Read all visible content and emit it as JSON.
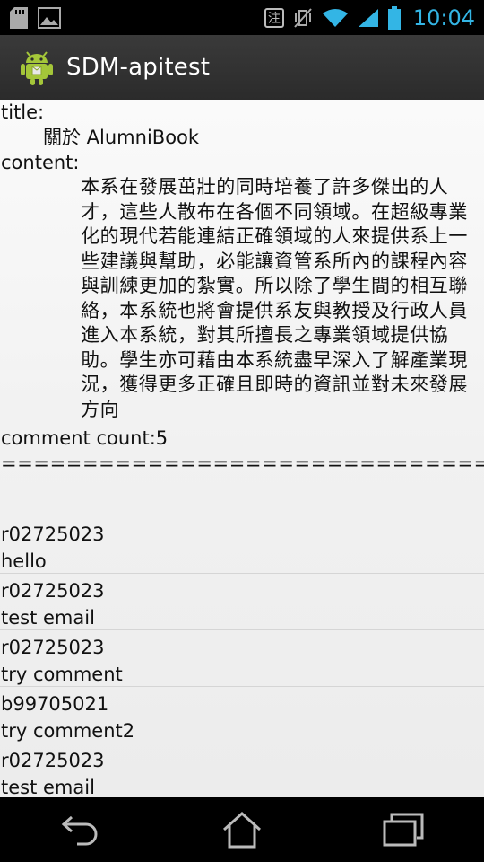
{
  "status_bar": {
    "ime_label": "注",
    "time": "10:04"
  },
  "action_bar": {
    "title": "SDM-apitest",
    "icon": "android-robot-icon"
  },
  "post": {
    "title_label": "title:",
    "title_value": "關於 AlumniBook",
    "content_label": "content:",
    "content_value": "本系在發展茁壯的同時培養了許多傑出的人才，這些人散布在各個不同領域。在超級專業化的現代若能連結正確領域的人來提供系上一些建議與幫助，必能讓資管系所內的課程內容與訓練更加的紮實。所以除了學生間的相互聯絡，本系統也將會提供系友與教授及行政人員進入本系統，對其所擅長之專業領域提供協助。學生亦可藉由本系統盡早深入了解產業現況，獲得更多正確且即時的資訊並對未來發展方向",
    "comment_count_text": "comment count:5",
    "divider_text": "=================================="
  },
  "comments": [
    {
      "author": "r02725023",
      "body": "hello"
    },
    {
      "author": "r02725023",
      "body": "test email"
    },
    {
      "author": "r02725023",
      "body": "try comment"
    },
    {
      "author": "b99705021",
      "body": "try comment2"
    },
    {
      "author": "r02725023",
      "body": "test email"
    }
  ],
  "colors": {
    "status_accent": "#33b5e5",
    "action_bar_bg": "#333333",
    "nav_bar_bg": "#000000"
  }
}
